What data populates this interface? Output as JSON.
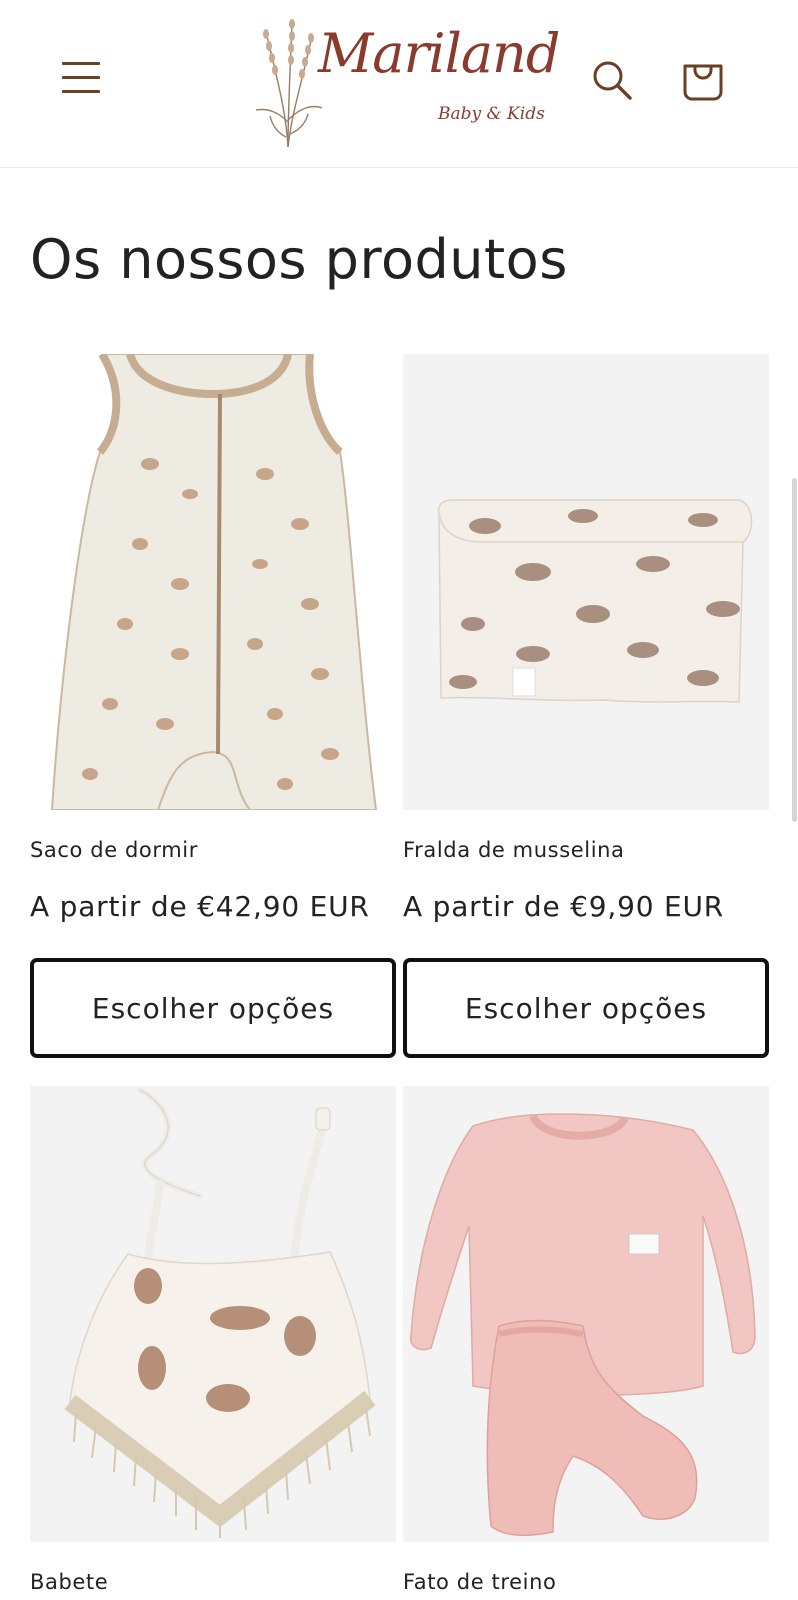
{
  "header": {
    "brand_name": "Mariland",
    "brand_tagline": "Baby & Kids",
    "menu_icon": "hamburger-menu-icon",
    "search_icon": "search-icon",
    "cart_icon": "cart-icon"
  },
  "colors": {
    "brand": "#8a3b2e",
    "header_icons": "#6b3f22",
    "button_border": "#111111",
    "image_background": "#f3f3f3"
  },
  "main": {
    "section_title": "Os nossos produtos",
    "products": [
      {
        "name": "Saco de dormir",
        "price": "A partir de €42,90 EUR",
        "button": "Escolher opções",
        "image": "sleeping-bag-dog-print-image"
      },
      {
        "name": "Fralda de musselina",
        "price": "A partir de €9,90 EUR",
        "button": "Escolher opções",
        "image": "muslin-swaddle-hedgehog-image"
      },
      {
        "name": "Babete",
        "image": "bib-dog-print-image"
      },
      {
        "name": "Fato de treino",
        "image": "pink-tracksuit-image"
      }
    ]
  }
}
